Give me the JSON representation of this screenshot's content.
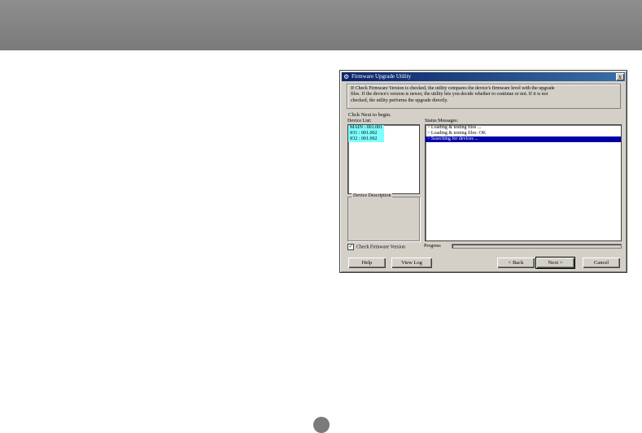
{
  "window": {
    "title": "Firmware Upgrade Utility",
    "close_glyph": "x"
  },
  "info": {
    "line1": "If Check Firmware Version is checked, the utility compares the device's firmware level with the upgrade",
    "line2": "files. If the device's version is newer, the utility lets you decide whether to continue or not. If it is not",
    "line3": "checked, the utility performs the upgrade directly."
  },
  "click_next": "Click Next to begin.",
  "device_list": {
    "label": "Device List:",
    "items": [
      "MAIN : 001.001",
      "IO1 : 001.002",
      "IO2 : 001.002"
    ]
  },
  "status": {
    "label": "Status Messages:",
    "items": [
      "> Loading & testing files ...",
      "> Loading & testing files: OK",
      "> Searching for devices ..."
    ]
  },
  "device_description": {
    "label": "Device Description"
  },
  "check_firmware": {
    "label": "Check Firmware Version",
    "checked": true
  },
  "progress": {
    "label": "Progress",
    "value": 0
  },
  "buttons": {
    "help": "Help",
    "view_log": "View Log",
    "back": "< Back",
    "next": "Next >",
    "cancel": "Cancel"
  }
}
